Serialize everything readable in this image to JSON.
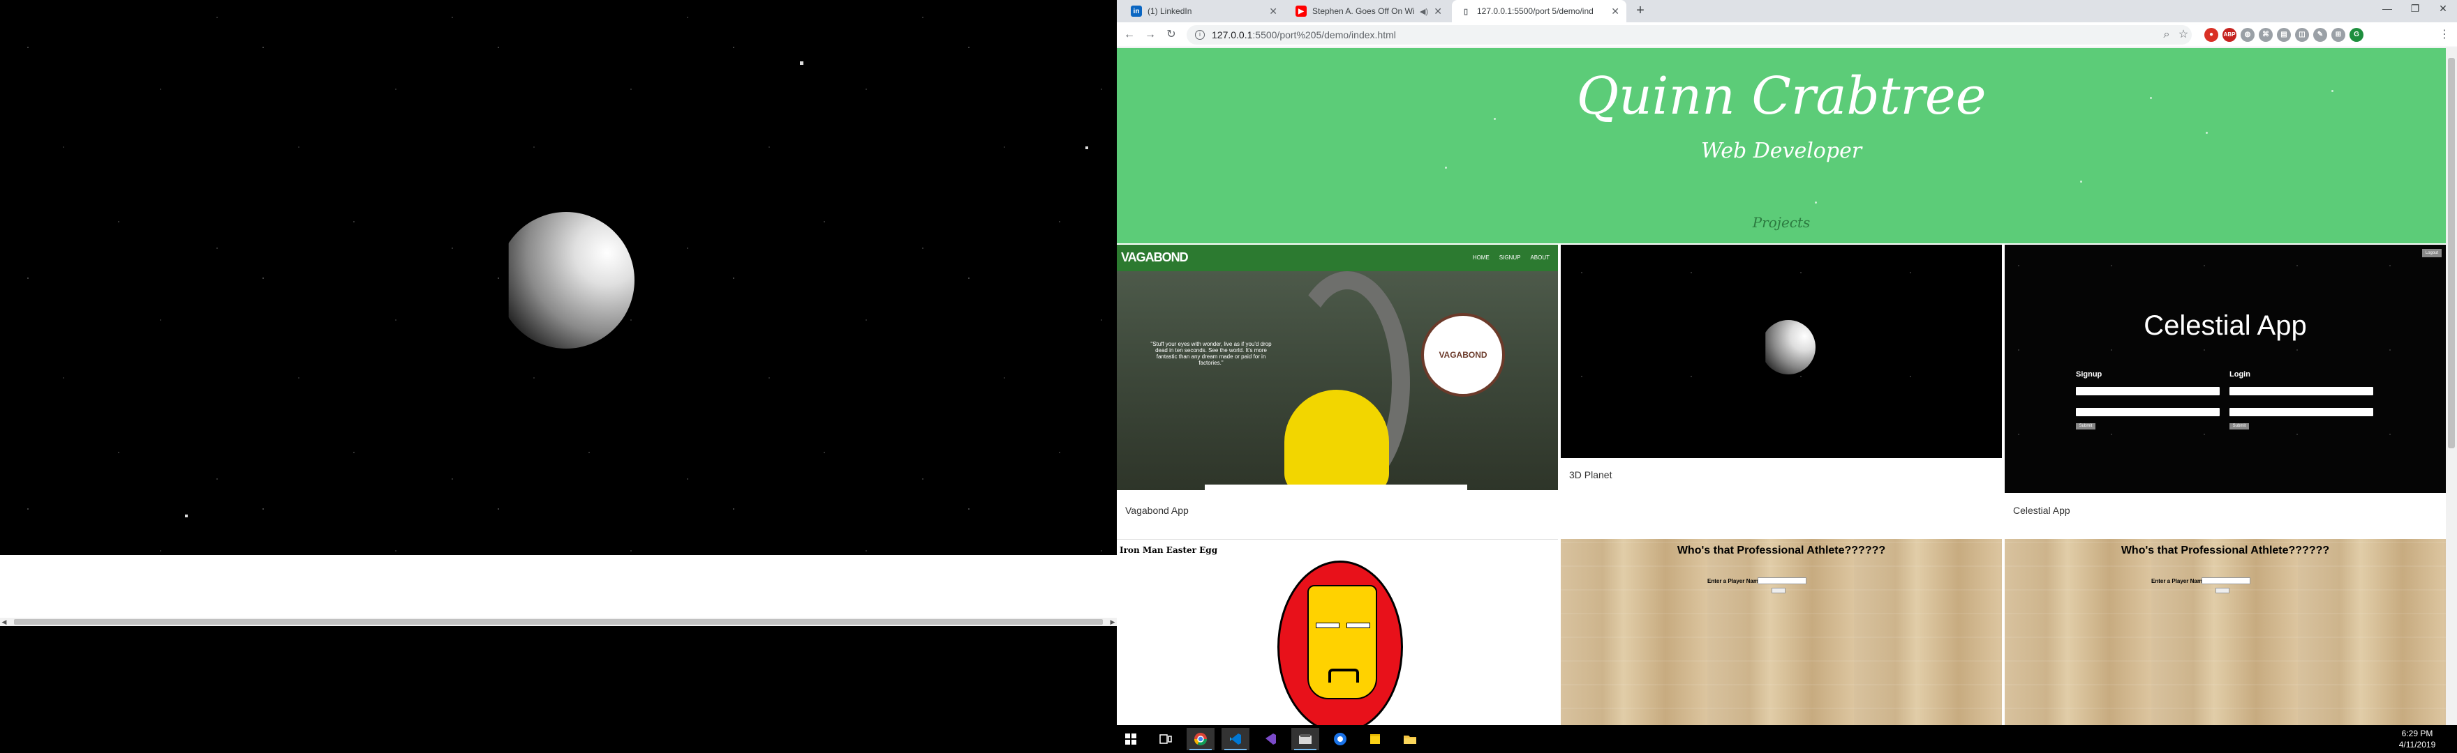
{
  "browser": {
    "tabs": [
      {
        "label": "(1) LinkedIn",
        "favicon": "in",
        "color": "#0a66c2"
      },
      {
        "label": "Stephen A. Goes Off On Wi",
        "favicon": "▶",
        "color": "#ff0000"
      },
      {
        "label": "127.0.0.1:5500/port 5/demo/ind",
        "favicon": "📄",
        "color": "#9aa0a6"
      }
    ],
    "url_host": "127.0.0.1",
    "url_rest": ":5500/port%205/demo/index.html"
  },
  "page": {
    "name": "Quinn Crabtree",
    "role": "Web Developer",
    "nav_link": "Projects",
    "projects": [
      {
        "caption": "Vagabond App"
      },
      {
        "caption": "3D Planet"
      },
      {
        "caption": "Celestial App"
      },
      {
        "caption": ""
      },
      {
        "caption": ""
      },
      {
        "caption": ""
      }
    ],
    "vagabond": {
      "logo": "VAGABOND",
      "links": [
        "HOME",
        "SIGNUP",
        "ABOUT"
      ],
      "quote": "\"Stuff your eyes with wonder, live as if you'd drop dead in ten seconds. See the world. It's more fantastic than any dream made or paid for in factories.\"",
      "badge": "VAGABOND"
    },
    "celestial": {
      "title": "Celestial App",
      "signup_label": "Signup",
      "login_label": "Login",
      "logout": "Logout",
      "submit": "Submit"
    },
    "ironman": {
      "title": "Iron Man Easter Egg"
    },
    "athlete": {
      "title": "Who's that Professional Athlete??????",
      "input_label": "Enter a Player Name:"
    }
  },
  "taskbar": {
    "time": "6:29 PM",
    "date": "4/11/2019",
    "apps": [
      "windows-start",
      "task-view",
      "chrome",
      "vscode",
      "visual-studio",
      "file-explorer-ext",
      "chrome-alt",
      "sticky-notes",
      "file-explorer"
    ]
  }
}
